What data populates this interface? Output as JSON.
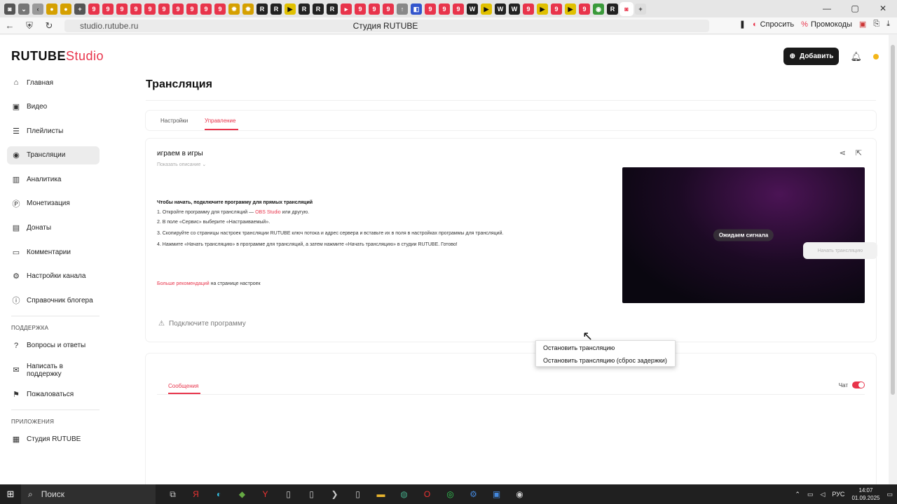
{
  "browser": {
    "url": "studio.rutube.ru",
    "page_title": "Студия RUTUBE",
    "ask_label": "Спросить",
    "promo_label": "Промокоды"
  },
  "app": {
    "logo_main": "RUTUBE",
    "logo_studio": "Studio",
    "add_button": "Добавить"
  },
  "sidebar": {
    "items": [
      {
        "label": "Главная",
        "icon": "home-icon"
      },
      {
        "label": "Видео",
        "icon": "video-icon"
      },
      {
        "label": "Плейлисты",
        "icon": "playlist-icon"
      },
      {
        "label": "Трансляции",
        "icon": "broadcast-icon"
      },
      {
        "label": "Аналитика",
        "icon": "analytics-icon"
      },
      {
        "label": "Монетизация",
        "icon": "monetization-icon"
      },
      {
        "label": "Донаты",
        "icon": "donate-icon"
      },
      {
        "label": "Комментарии",
        "icon": "comments-icon"
      },
      {
        "label": "Настройки канала",
        "icon": "settings-icon"
      },
      {
        "label": "Справочник блогера",
        "icon": "info-icon"
      }
    ],
    "support_heading": "ПОДДЕРЖКА",
    "support_items": [
      {
        "label": "Вопросы и ответы",
        "icon": "faq-icon"
      },
      {
        "label": "Написать в поддержку",
        "icon": "mail-icon"
      },
      {
        "label": "Пожаловаться",
        "icon": "flag-icon"
      }
    ],
    "apps_heading": "ПРИЛОЖЕНИЯ",
    "apps_items": [
      {
        "label": "Студия RUTUBE",
        "icon": "studio-app-icon"
      }
    ]
  },
  "page": {
    "title": "Трансляция",
    "tabs": [
      "Настройки",
      "Управление"
    ],
    "stream_name": "играем в игры",
    "show_description": "Показать описание",
    "instructions_head": "Чтобы начать, подключите программу для прямых трансляций",
    "step1_a": "1. Откройте программу для трансляций — ",
    "step1_link": "OBS Studio",
    "step1_b": " или другую.",
    "step2": "2. В поле «Сервис» выберите «Настраиваемый».",
    "step3": "3. Скопируйте со страницы настроек трансляции RUTUBE ключ потока и адрес сервера и вставьте их в поля в настройках программы для трансляций.",
    "step4": "4. Нажмите «Начать трансляцию» в программе для трансляций, а затем нажмите «Начать трансляцию» в студии RUTUBE. Готово!",
    "more_link": "Больше рекомендаций",
    "more_rest": " на странице настроек",
    "connect_status": "Подключите программу",
    "waiting_signal": "Ожидаем сигнала",
    "start_button": "Начать трансляцию",
    "messages_tab": "Сообщения",
    "chat_label": "Чат"
  },
  "dropdown": {
    "items": [
      "Остановить трансляцию",
      "Остановить трансляцию (сброс задержки)"
    ]
  },
  "taskbar": {
    "search": "Поиск",
    "lang": "РУС",
    "time": "14:07",
    "date": "01.09.2025"
  },
  "colors": {
    "accent": "#e8344b",
    "help": "#1aa6a0"
  }
}
